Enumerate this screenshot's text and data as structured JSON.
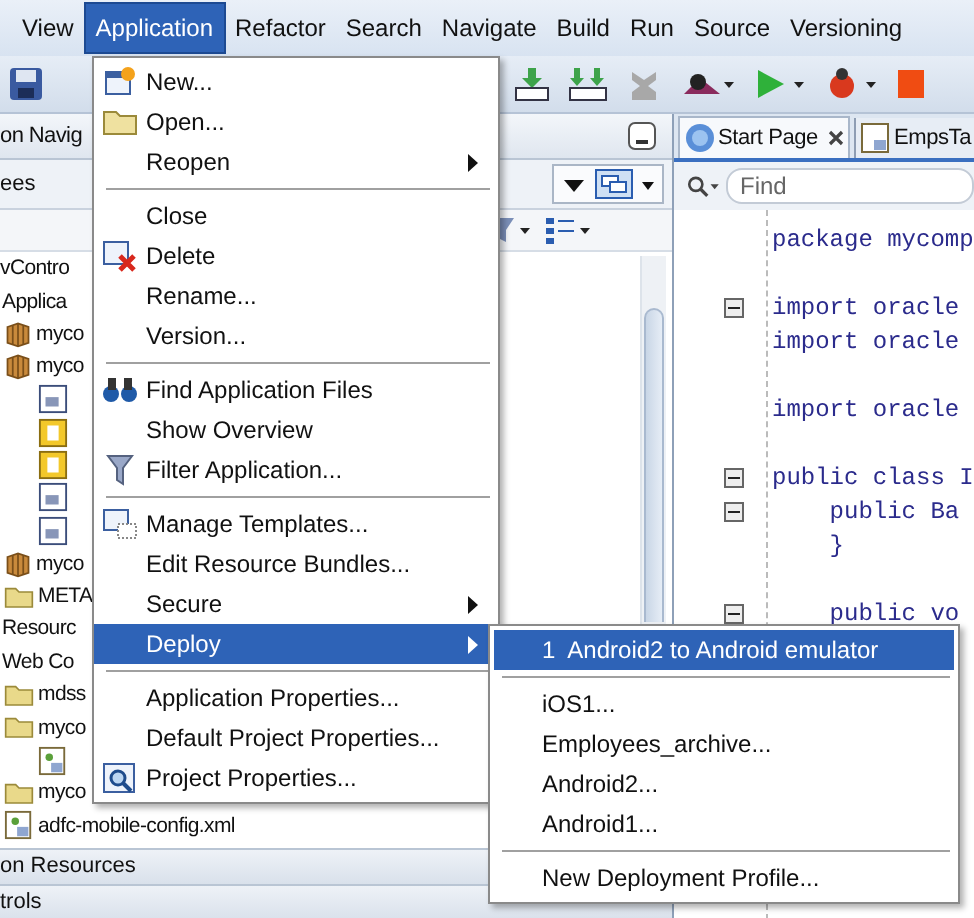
{
  "menubar": [
    {
      "label": "View",
      "selected": false
    },
    {
      "label": "Application",
      "selected": true
    },
    {
      "label": "Refactor",
      "selected": false
    },
    {
      "label": "Search",
      "selected": false
    },
    {
      "label": "Navigate",
      "selected": false
    },
    {
      "label": "Build",
      "selected": false
    },
    {
      "label": "Run",
      "selected": false
    },
    {
      "label": "Source",
      "selected": false
    },
    {
      "label": "Versioning",
      "selected": false
    }
  ],
  "navigator": {
    "title": "on Navig",
    "selector": "ees",
    "tree": [
      {
        "label": "vContro",
        "children": [
          {
            "label": "Applica",
            "children": [
              {
                "label": "myco",
                "kind": "package"
              },
              {
                "label": "myco",
                "kind": "package",
                "children": [
                  {
                    "kind": "page"
                  },
                  {
                    "kind": "task"
                  },
                  {
                    "kind": "task"
                  },
                  {
                    "kind": "page"
                  },
                  {
                    "kind": "page"
                  }
                ]
              },
              {
                "label": "myco",
                "kind": "package"
              },
              {
                "label": "META",
                "kind": "folder"
              }
            ]
          },
          {
            "label": "Resourc"
          },
          {
            "label": "Web Co",
            "children": [
              {
                "label": "mdss",
                "kind": "folder"
              },
              {
                "label": "myco",
                "kind": "folder",
                "children": [
                  {
                    "kind": "config"
                  }
                ]
              },
              {
                "label": "myco",
                "kind": "folder"
              },
              {
                "label": "adfc-mobile-config.xml",
                "kind": "config"
              }
            ]
          }
        ]
      }
    ],
    "footer": [
      "on Resources",
      "trols"
    ]
  },
  "editor": {
    "tabs": [
      {
        "label": "Start Page",
        "selected": true,
        "closable": true
      },
      {
        "label": "EmpsTa",
        "selected": false,
        "closable": false
      }
    ],
    "find": {
      "placeholder": "Find"
    },
    "lines": [
      {
        "text": "package mycomp",
        "fold": false
      },
      {
        "fold": false
      },
      {
        "text": "import oracle",
        "fold": true
      },
      {
        "text": "import oracle",
        "fold": false
      },
      {
        "fold": false
      },
      {
        "text": "import oracle",
        "fold": false
      },
      {
        "fold": false
      },
      {
        "text": "public class I",
        "fold": true
      },
      {
        "text": "    public Ba",
        "fold": true
      },
      {
        "text": "    }",
        "fold": false
      },
      {
        "fold": false
      },
      {
        "text": "    public vo",
        "fold": true
      }
    ]
  },
  "menu": {
    "items": [
      {
        "kind": "item",
        "label": "New...",
        "submenu": false,
        "selected": false
      },
      {
        "kind": "item",
        "label": "Open...",
        "submenu": false,
        "selected": false
      },
      {
        "kind": "item",
        "label": "Reopen",
        "submenu": true,
        "selected": false
      },
      {
        "kind": "separator"
      },
      {
        "kind": "item",
        "label": "Close",
        "submenu": false,
        "selected": false
      },
      {
        "kind": "item",
        "label": "Delete",
        "submenu": false,
        "selected": false
      },
      {
        "kind": "item",
        "label": "Rename...",
        "submenu": false,
        "selected": false
      },
      {
        "kind": "item",
        "label": "Version...",
        "submenu": false,
        "selected": false
      },
      {
        "kind": "separator"
      },
      {
        "kind": "item",
        "label": "Find Application Files",
        "submenu": false,
        "selected": false
      },
      {
        "kind": "item",
        "label": "Show Overview",
        "submenu": false,
        "selected": false
      },
      {
        "kind": "item",
        "label": "Filter Application...",
        "submenu": false,
        "selected": false
      },
      {
        "kind": "separator"
      },
      {
        "kind": "item",
        "label": "Manage Templates...",
        "submenu": false,
        "selected": false
      },
      {
        "kind": "item",
        "label": "Edit Resource Bundles...",
        "submenu": false,
        "selected": false
      },
      {
        "kind": "item",
        "label": "Secure",
        "submenu": true,
        "selected": false
      },
      {
        "kind": "item",
        "label": "Deploy",
        "submenu": true,
        "selected": true
      },
      {
        "kind": "separator"
      },
      {
        "kind": "item",
        "label": "Application Properties...",
        "submenu": false,
        "selected": false
      },
      {
        "kind": "item",
        "label": "Default Project Properties...",
        "submenu": false,
        "selected": false
      },
      {
        "kind": "item",
        "label": "Project Properties...",
        "submenu": false,
        "selected": false
      }
    ]
  },
  "submenu": {
    "items": [
      {
        "kind": "item",
        "label": "1  Android2 to Android emulator",
        "selected": true
      },
      {
        "kind": "separator"
      },
      {
        "kind": "item",
        "label": "iOS1...",
        "selected": false
      },
      {
        "kind": "item",
        "label": "Employees_archive...",
        "selected": false
      },
      {
        "kind": "item",
        "label": "Android2...",
        "selected": false
      },
      {
        "kind": "item",
        "label": "Android1...",
        "selected": false
      },
      {
        "kind": "separator"
      },
      {
        "kind": "item",
        "label": "New Deployment Profile...",
        "selected": false
      }
    ]
  }
}
